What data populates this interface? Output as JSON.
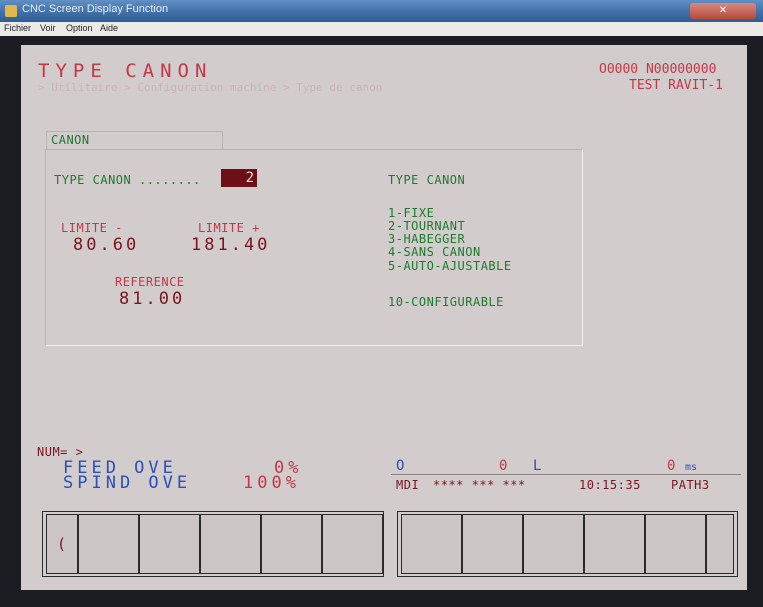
{
  "window": {
    "title": "CNC Screen Display Function",
    "close_label": "✕"
  },
  "menu": [
    "Fichier",
    "Voir",
    "Option",
    "Aide"
  ],
  "header": {
    "title": "TYPE CANON",
    "breadcrumb": "> Utilitaire > Configuration machine > Type de canon",
    "program": "O0000 N00000000",
    "machine": "TEST RAVIT-1"
  },
  "panel": {
    "tab": "CANON",
    "type_label": "TYPE CANON ........",
    "type_value": "2",
    "limit_minus_label": "LIMITE -",
    "limit_minus_value": "80.60",
    "limit_plus_label": "LIMITE +",
    "limit_plus_value": "181.40",
    "reference_label": "REFERENCE",
    "reference_value": "81.00",
    "options_title": "TYPE CANON",
    "options": [
      "1-FIXE",
      "2-TOURNANT",
      "3-HABEGGER",
      "4-SANS CANON",
      "5-AUTO-AJUSTABLE"
    ],
    "option_extra": "10-CONFIGURABLE"
  },
  "status": {
    "num_prompt": "NUM= >",
    "feed_label": "FEED OVE",
    "feed_value": "0%",
    "spind_label": "SPIND OVE",
    "spind_value": "100%",
    "o_label": "O",
    "o_value": "0",
    "l_label": "L",
    "ms_value": "0",
    "ms_unit": "ms",
    "mode": "MDI",
    "mode_stars": "**** *** ***",
    "time": "10:15:35",
    "path": "PATH3"
  },
  "softkeys": {
    "prev_label": "("
  }
}
